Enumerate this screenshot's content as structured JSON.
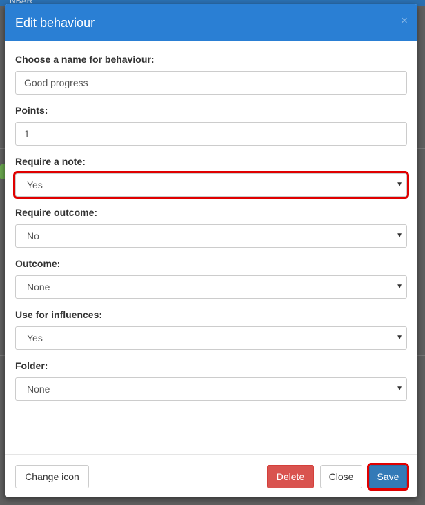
{
  "background": {
    "top_text": "NBAR"
  },
  "modal": {
    "title": "Edit behaviour",
    "close_symbol": "×",
    "fields": {
      "name": {
        "label": "Choose a name for behaviour:",
        "value": "Good progress"
      },
      "points": {
        "label": "Points:",
        "value": "1"
      },
      "require_note": {
        "label": "Require a note:",
        "value": "Yes"
      },
      "require_outcome": {
        "label": "Require outcome:",
        "value": "No"
      },
      "outcome": {
        "label": "Outcome:",
        "value": "None"
      },
      "influences": {
        "label": "Use for influences:",
        "value": "Yes"
      },
      "folder": {
        "label": "Folder:",
        "value": "None"
      }
    },
    "footer": {
      "change_icon": "Change icon",
      "delete": "Delete",
      "close": "Close",
      "save": "Save"
    }
  },
  "colors": {
    "header": "#2a7fd4",
    "delete": "#d9534f",
    "save": "#337ab7",
    "highlight": "#e00000"
  },
  "caret_symbol": "▼"
}
